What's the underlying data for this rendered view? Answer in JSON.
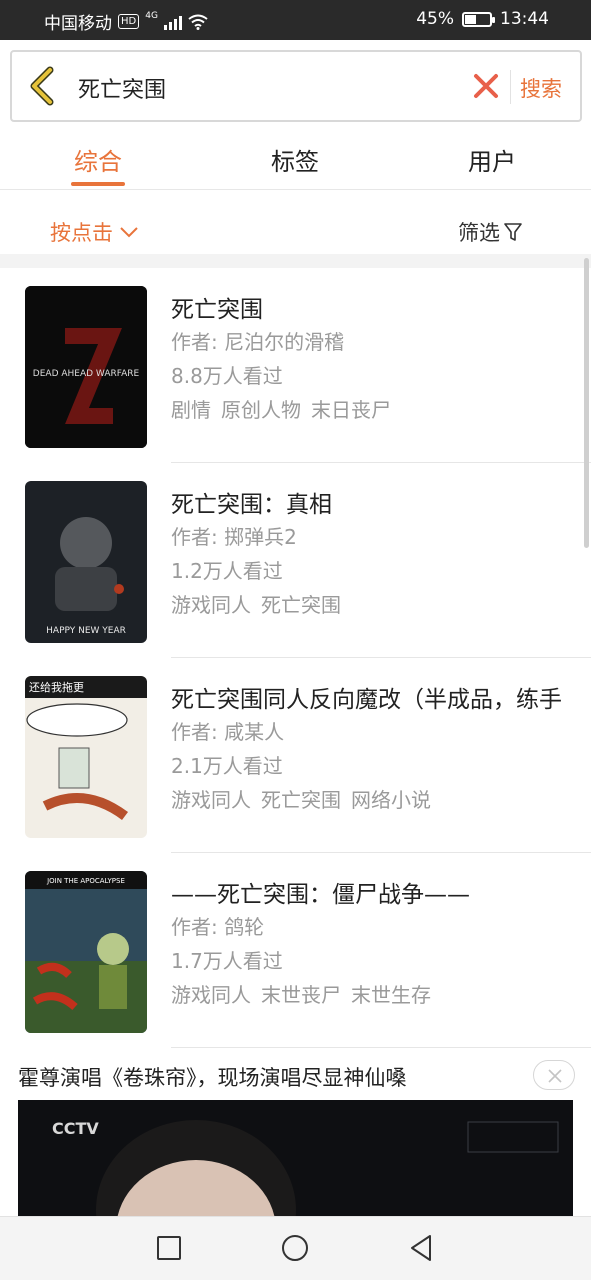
{
  "status_bar": {
    "carrier": "中国移动",
    "hd": "HD",
    "network": "4G",
    "battery_percent": "45%",
    "battery_level": 0.45,
    "time": "13:44"
  },
  "search": {
    "query": "死亡突围",
    "search_label": "搜索"
  },
  "tabs": [
    {
      "label": "综合",
      "active": true
    },
    {
      "label": "标签",
      "active": false
    },
    {
      "label": "用户",
      "active": false
    }
  ],
  "sort": {
    "sort_label": "按点击",
    "filter_label": "筛选"
  },
  "results": [
    {
      "title": "死亡突围",
      "author": "作者: 尼泊尔的滑稽",
      "views": "8.8万人看过",
      "tags": [
        "剧情",
        "原创人物",
        "末日丧尸"
      ],
      "cover_text": "DEAD AHEAD WARFARE"
    },
    {
      "title": "死亡突围：真相",
      "author": "作者: 掷弹兵2",
      "views": "1.2万人看过",
      "tags": [
        "游戏同人",
        "死亡突围"
      ],
      "cover_text": "HAPPY NEW YEAR"
    },
    {
      "title": "死亡突围同人反向魔改（半成品，练手",
      "author": "作者: 咸某人",
      "views": "2.1万人看过",
      "tags": [
        "游戏同人",
        "死亡突围",
        "网络小说"
      ],
      "cover_text": "还给我拖更"
    },
    {
      "title": "——死亡突围：僵尸战争——",
      "author": "作者: 鸽轮",
      "views": "1.7万人看过",
      "tags": [
        "游戏同人",
        "末世丧尸",
        "末世生存"
      ],
      "cover_text": "JOIN THE APOCALYPSE"
    }
  ],
  "ad": {
    "title": "霍尊演唱《卷珠帘》，现场演唱尽显神仙嗓",
    "logo_text": "CCTV"
  },
  "colors": {
    "accent": "#e8743b",
    "secondary_text": "#9a9a9a"
  }
}
